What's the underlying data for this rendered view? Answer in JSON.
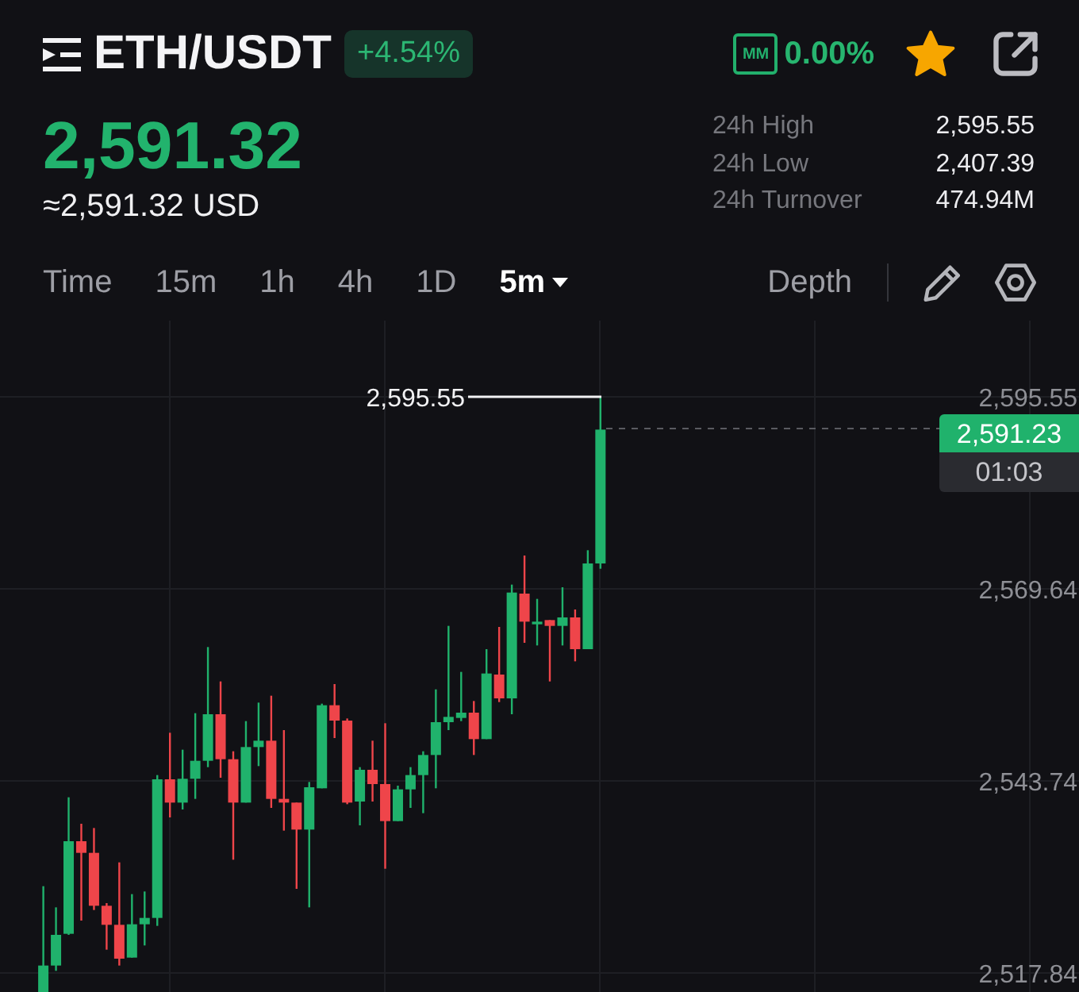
{
  "header": {
    "pair": "ETH/USDT",
    "change": "+4.54%",
    "mm_badge": "MM",
    "mm_rate": "0.00%",
    "favorited": true
  },
  "price": {
    "last": "2,591.32",
    "fiat": "≈2,591.32 USD"
  },
  "stats": [
    {
      "label": "24h High",
      "value": "2,595.55"
    },
    {
      "label": "24h Low",
      "value": "2,407.39"
    },
    {
      "label": "24h Turnover",
      "value": "474.94M"
    }
  ],
  "intervals": [
    {
      "label": "Time",
      "selected": false,
      "dropdown": false
    },
    {
      "label": "15m",
      "selected": false,
      "dropdown": false
    },
    {
      "label": "1h",
      "selected": false,
      "dropdown": false
    },
    {
      "label": "4h",
      "selected": false,
      "dropdown": false
    },
    {
      "label": "1D",
      "selected": false,
      "dropdown": false
    },
    {
      "label": "5m",
      "selected": true,
      "dropdown": true
    }
  ],
  "depth_tab": {
    "label": "Depth",
    "selected": false
  },
  "chart": {
    "high_marker": "2,595.55",
    "last_price_tag": "2,591.23",
    "countdown": "01:03",
    "y_axis_labels": [
      "2,595.55",
      "2,569.64",
      "2,543.74",
      "2,517.84"
    ]
  }
}
